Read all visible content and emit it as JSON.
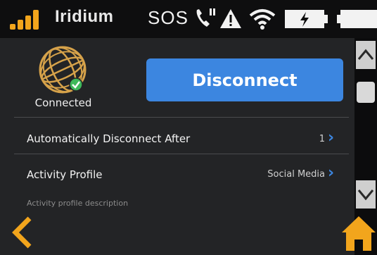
{
  "status_bar": {
    "carrier": "Iridium",
    "sos": "SOS",
    "icons": [
      "signal-bars-icon",
      "phone-icon",
      "warning-icon",
      "wifi-icon",
      "battery-charging-icon",
      "battery-icon"
    ],
    "accent_color": "#f2a51c"
  },
  "connection": {
    "status_label": "Connected",
    "disconnect_label": "Disconnect",
    "icon": "globe-icon"
  },
  "settings": {
    "auto_disconnect": {
      "label": "Automatically Disconnect After",
      "value": "1"
    },
    "activity_profile": {
      "label": "Activity Profile",
      "value": "Social Media",
      "description": "Activity profile description"
    }
  },
  "nav": {
    "back_icon": "chevron-left-icon",
    "home_icon": "home-icon"
  },
  "scrollbar": {
    "up_icon": "chevron-up-icon",
    "down_icon": "chevron-down-icon"
  },
  "colors": {
    "button_blue": "#3c86e0",
    "globe_gold": "#d6a24a",
    "check_green": "#3fb95a"
  }
}
